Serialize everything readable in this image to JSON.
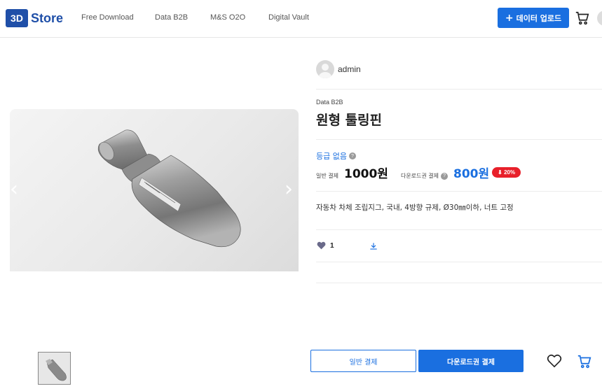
{
  "header": {
    "logo_mark": "3D",
    "logo_text": "Store",
    "nav": [
      "Free Download",
      "Data B2B",
      "M&S O2O",
      "Digital Vault"
    ],
    "upload_label": "데이터 업로드",
    "upload_icon": "plus-icon",
    "cart_icon": "cart-icon"
  },
  "gallery": {
    "prev_icon": "chevron-left-icon",
    "next_icon": "chevron-right-icon",
    "thumbnails": 1
  },
  "product": {
    "seller": "admin",
    "category": "Data B2B",
    "title": "원형 툴링핀",
    "grade": "등급 없음",
    "normal_label": "일반 결제",
    "normal_price": "1000원",
    "download_label": "다운로드권 결제",
    "download_price": "800원",
    "discount": "⬇ 20%",
    "description": "자동차 차체 조립지그, 국내, 4방향 규제, Ø30㎜이하, 너트 고정",
    "likes": "1"
  },
  "actions": {
    "normal_pay": "일반 결제",
    "download_pay": "다운로드권 결제"
  },
  "colors": {
    "accent": "#1a6fe0",
    "brand": "#1f4fa8",
    "discount": "#e8202a"
  }
}
